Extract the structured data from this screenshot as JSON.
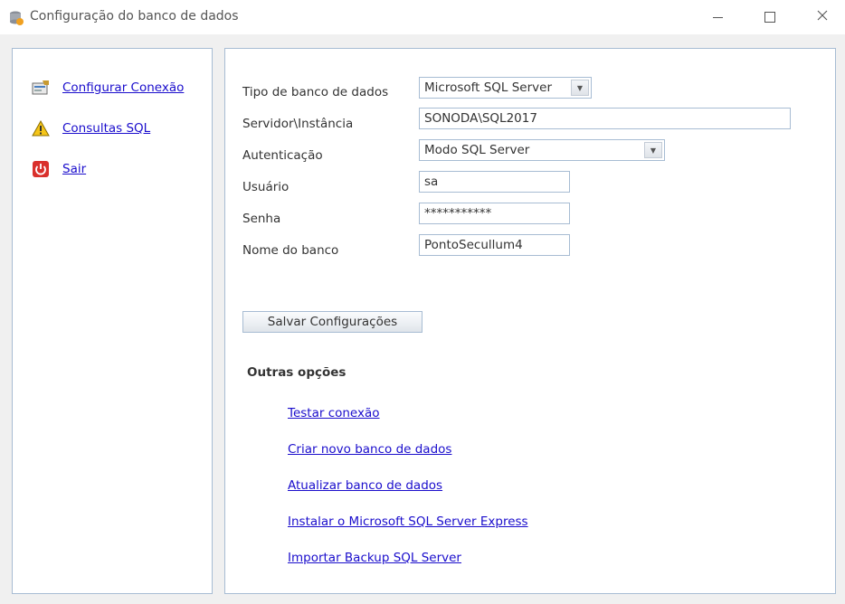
{
  "window": {
    "title": "Configuração do banco de dados",
    "app_icon": "database-icon",
    "controls": [
      "minimize-icon",
      "maximize-icon",
      "close-icon"
    ]
  },
  "sidebar": {
    "items": [
      {
        "label": "Configurar Conexão",
        "icon": "connection-config-icon"
      },
      {
        "label": "Consultas SQL",
        "icon": "warning-icon"
      },
      {
        "label": "Sair",
        "icon": "power-icon"
      }
    ]
  },
  "form": {
    "db_type": {
      "label": "Tipo de banco de dados",
      "value": "Microsoft SQL Server"
    },
    "server": {
      "label": "Servidor\\Instância",
      "value": "SONODA\\SQL2017"
    },
    "auth": {
      "label": "Autenticação",
      "value": "Modo SQL Server"
    },
    "user": {
      "label": "Usuário",
      "value": "sa"
    },
    "password": {
      "label": "Senha",
      "value": "***********"
    },
    "db_name": {
      "label": "Nome do banco",
      "value": "PontoSecullum4"
    },
    "save_label": "Salvar Configurações"
  },
  "other_options": {
    "title": "Outras opções",
    "links": [
      "Testar conexão",
      "Criar novo banco de dados",
      "Atualizar banco de dados",
      "Instalar o Microsoft SQL Server Express",
      "Importar Backup SQL Server"
    ]
  },
  "colors": {
    "link": "#1a0dcc",
    "panel_border": "#a7bcd3",
    "background": "#f0f0f0"
  }
}
